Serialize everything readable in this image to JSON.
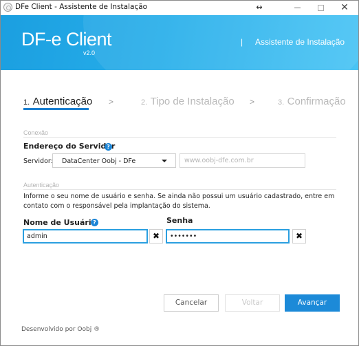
{
  "window": {
    "title": "DFe Client - Assistente de Instalação",
    "resize_glyph": "↔",
    "close_glyph": "✕"
  },
  "header": {
    "logo": "DF-e Client",
    "version": "v2.0",
    "separator": "|",
    "subtitle": "Assistente de Instalação",
    "gradient_start": "#1b9fe0",
    "gradient_end": "#49c4f4"
  },
  "steps": [
    {
      "number": "1.",
      "label": "Autenticação",
      "active": true
    },
    {
      "number": "2.",
      "label": "Tipo de Instalação",
      "active": false
    },
    {
      "number": "3.",
      "label": "Confirmação",
      "active": false
    }
  ],
  "step_separator": ">",
  "connection": {
    "section_title": "Conexão",
    "server_title": "Endereço do Servidor",
    "help_glyph": "?",
    "server_label": "Servidor:",
    "server_selected": "DataCenter Oobj - DFe",
    "url_placeholder": "www.oobj-dfe.com.br"
  },
  "authentication": {
    "section_title": "Autenticação",
    "info": "Informe o seu nome de usuário e senha. Se ainda não possui um usuário cadastrado, entre em contato com o responsável pela implantação do sistema.",
    "username_title": "Nome de Usuário",
    "username_value": "admin",
    "password_title": "Senha",
    "password_value": "•••••••",
    "clear_glyph": "✖"
  },
  "buttons": {
    "cancel": "Cancelar",
    "back": "Voltar",
    "next": "Avançar",
    "accent": "#1c8ad8"
  },
  "footer": {
    "text": "Desenvolvido por Oobj ®"
  },
  "icons": {
    "app": "app-icon",
    "help": "help-icon",
    "dropdown": "chevron-down-icon",
    "clear": "close-icon"
  }
}
